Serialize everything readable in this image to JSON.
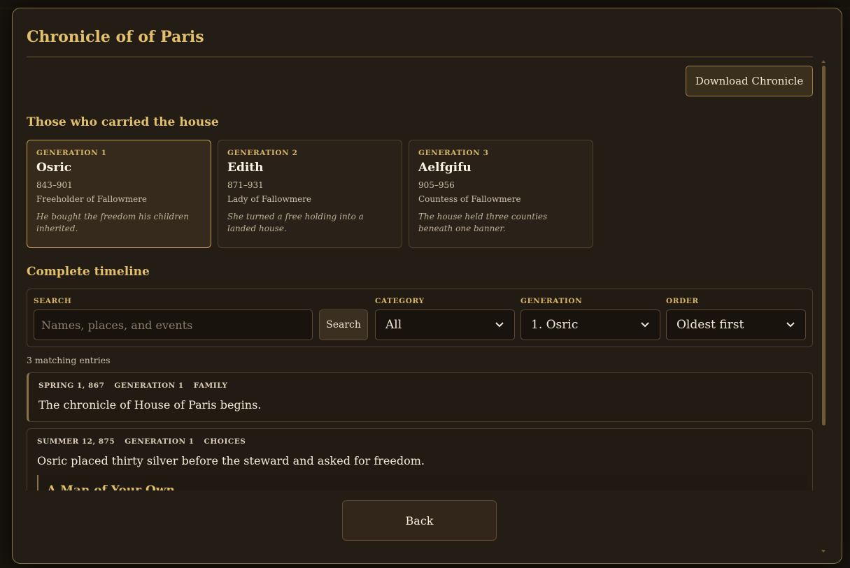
{
  "modal": {
    "title": "Chronicle of of Paris",
    "download_label": "Download Chronicle",
    "back_label": "Back"
  },
  "generations_section": {
    "heading": "Those who carried the house",
    "cards": [
      {
        "label": "GENERATION 1",
        "name": "Osric",
        "years": "843–901",
        "title": "Freeholder of Fallowmere",
        "quote": "He bought the freedom his children inherited.",
        "active": true
      },
      {
        "label": "GENERATION 2",
        "name": "Edith",
        "years": "871–931",
        "title": "Lady of Fallowmere",
        "quote": "She turned a free holding into a landed house.",
        "active": false
      },
      {
        "label": "GENERATION 3",
        "name": "Aelfgifu",
        "years": "905–956",
        "title": "Countess of Fallowmere",
        "quote": "The house held three counties beneath one banner.",
        "active": false
      }
    ]
  },
  "timeline": {
    "heading": "Complete timeline",
    "filters": {
      "search_label": "SEARCH",
      "search_placeholder": "Names, places, and events",
      "search_button": "Search",
      "category_label": "CATEGORY",
      "category_value": "All",
      "generation_label": "GENERATION",
      "generation_value": "1. Osric",
      "order_label": "ORDER",
      "order_value": "Oldest first"
    },
    "match_count": "3 matching entries",
    "entries": [
      {
        "date": "SPRING 1, 867",
        "generation": "GENERATION 1",
        "category": "FAMILY",
        "text": "The chronicle of House of Paris begins."
      },
      {
        "date": "SUMMER 12, 875",
        "generation": "GENERATION 1",
        "category": "CHOICES",
        "text": "Osric placed thirty silver before the steward and asked for freedom.",
        "choice_title": "A Man of Your Own"
      }
    ]
  }
}
